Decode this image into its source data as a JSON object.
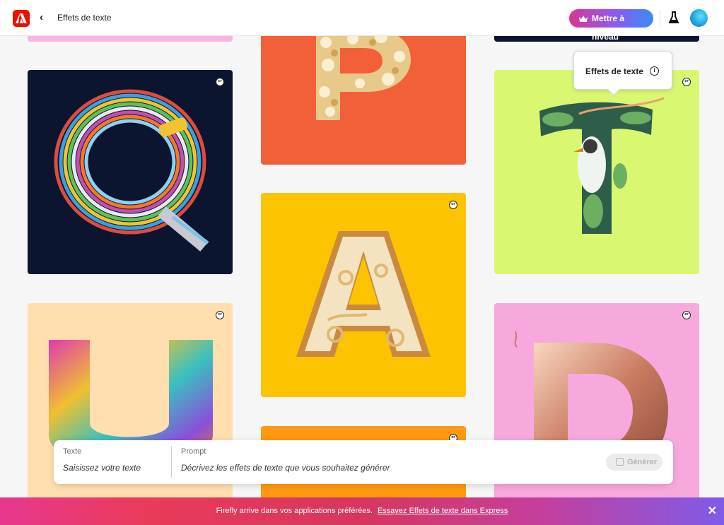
{
  "header": {
    "back_glyph": "‹",
    "title": "Effets de texte",
    "upgrade_label": "Mettre à niveau",
    "icons": [
      "adobe-logo-icon",
      "chevron-left-icon",
      "crown-icon",
      "flask-icon",
      "avatar"
    ]
  },
  "tooltip": {
    "label": "Effets de texte",
    "info_glyph": "i"
  },
  "cards": [
    {
      "letter": "Q",
      "theme": "colored wires",
      "badge": "cr"
    },
    {
      "letter": "P",
      "theme": "popcorn",
      "badge": "cr"
    },
    {
      "letter": "A",
      "theme": "bread and pasta",
      "badge": "cr"
    },
    {
      "letter": "T",
      "theme": "bird and foliage",
      "badge": "cr"
    },
    {
      "letter": "U",
      "theme": "colorful fur",
      "badge": "cr"
    },
    {
      "letter": "D",
      "theme": "rose gold balloon",
      "badge": "cr"
    }
  ],
  "prompt_bar": {
    "text_label": "Texte",
    "text_placeholder": "Saisissez votre texte",
    "prompt_label": "Prompt",
    "prompt_placeholder": "Décrivez les effets de texte que vous souhaitez générer",
    "generate_label": "Générer"
  },
  "banner": {
    "message": "Firefly arrive dans vos applications préférées.",
    "link": "Essayez Effets de texte dans Express",
    "close_glyph": "✕"
  },
  "colors": {
    "adobe_red": "#eb1000",
    "card_navy": "#0b1530",
    "card_orange": "#f2603a",
    "card_yellow": "#fcc400",
    "card_lime": "#d9f770",
    "card_peach": "#ffdfb0",
    "card_pink": "#f7a9dd",
    "card_orange2": "#ff9a10"
  }
}
